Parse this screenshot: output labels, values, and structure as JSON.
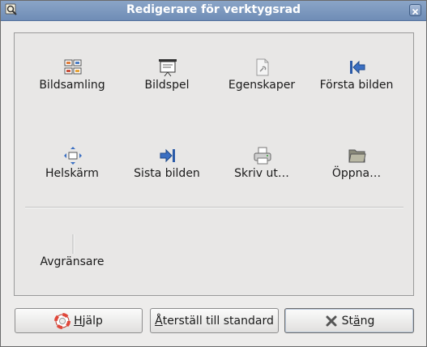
{
  "window": {
    "title": "Redigerare för verktygsrad"
  },
  "toolbar_items": [
    {
      "label": "Bildsamling",
      "icon": "image-collection-icon"
    },
    {
      "label": "Bildspel",
      "icon": "slideshow-icon"
    },
    {
      "label": "Egenskaper",
      "icon": "properties-icon"
    },
    {
      "label": "Första bilden",
      "icon": "go-first-icon"
    },
    {
      "label": "Helskärm",
      "icon": "fullscreen-icon"
    },
    {
      "label": "Sista bilden",
      "icon": "go-last-icon"
    },
    {
      "label": "Skriv ut…",
      "icon": "printer-icon"
    },
    {
      "label": "Öppna…",
      "icon": "open-folder-icon"
    }
  ],
  "separator_item": {
    "label": "Avgränsare"
  },
  "buttons": {
    "help": {
      "mnemonic": "H",
      "rest": "jälp"
    },
    "reset": {
      "mnemonic": "Å",
      "rest": "terställ till standard"
    },
    "close": {
      "pre": "St",
      "mnemonic": "ä",
      "post": "ng"
    }
  },
  "colors": {
    "titlebar": "#7b96bd",
    "accent_blue": "#2a5aa8"
  }
}
